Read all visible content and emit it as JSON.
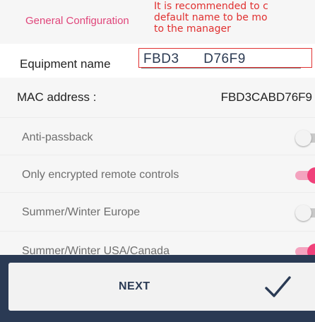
{
  "header": {
    "title": "General Configuration",
    "annotation": "It is recommended to c\ndefault name to be mo\nto the manager"
  },
  "equipment": {
    "label": "Equipment name",
    "value": "FBD3      D76F9"
  },
  "mac": {
    "label": "MAC address :",
    "value": "FBD3CABD76F9"
  },
  "options": [
    {
      "label": "Anti-passback",
      "enabled": false
    },
    {
      "label": "Only encrypted remote controls",
      "enabled": true
    },
    {
      "label": "Summer/Winter Europe",
      "enabled": false
    },
    {
      "label": "Summer/Winter USA/Canada",
      "enabled": true
    }
  ],
  "footer": {
    "next_label": "NEXT",
    "confirm_icon": "checkmark-icon"
  },
  "colors": {
    "accent": "#f0417a",
    "footer_bg": "#2a3a54",
    "annotation": "#e03030"
  }
}
